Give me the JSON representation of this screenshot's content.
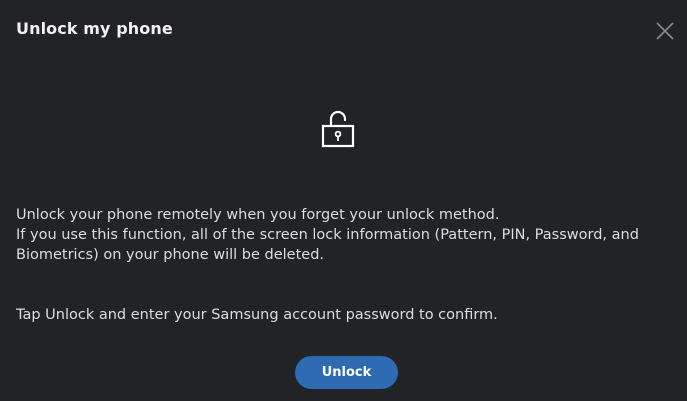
{
  "dialog": {
    "title": "Unlock my phone",
    "close_icon": "close-icon",
    "lock_icon": "unlock-icon",
    "description_lines": [
      "Unlock your phone remotely when you forget your unlock method.",
      "If you use this function, all of the screen lock information (Pattern, PIN, Password, and Biometrics) on your phone will be deleted."
    ],
    "confirm_text": "Tap Unlock and enter your Samsung account password to confirm.",
    "unlock_label": "Unlock"
  },
  "colors": {
    "background": "#222326",
    "accent": "#2f6bb3",
    "text": "#dcdde0"
  }
}
